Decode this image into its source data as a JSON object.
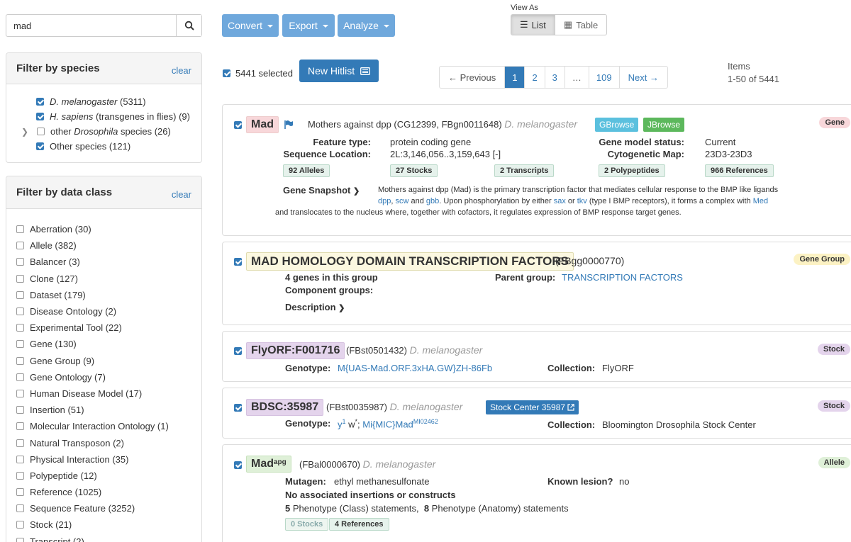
{
  "search": {
    "value": "mad"
  },
  "species_filter": {
    "title": "Filter by species",
    "clear": "clear",
    "items": [
      {
        "prefix": "",
        "italic": "D. melanogaster",
        "suffix": " (5311)",
        "checked": true
      },
      {
        "prefix": "",
        "italic": "H. sapiens",
        "suffix": " (transgenes in flies) (9)",
        "checked": true
      },
      {
        "prefix": "other ",
        "italic": "Drosophila",
        "suffix": " species (26)",
        "checked": false
      },
      {
        "prefix": "Other species (121)",
        "italic": "",
        "suffix": "",
        "checked": true
      }
    ]
  },
  "class_filter": {
    "title": "Filter by data class",
    "clear": "clear",
    "items": [
      "Aberration (30)",
      "Allele (382)",
      "Balancer (3)",
      "Clone (127)",
      "Dataset (179)",
      "Disease Ontology (2)",
      "Experimental Tool (22)",
      "Gene (130)",
      "Gene Group (9)",
      "Gene Ontology (7)",
      "Human Disease Model (17)",
      "Insertion (51)",
      "Molecular Interaction Ontology (1)",
      "Natural Transposon (2)",
      "Physical Interaction (35)",
      "Polypeptide (12)",
      "Reference (1025)",
      "Sequence Feature (3252)",
      "Stock (21)",
      "Transcript (2)"
    ]
  },
  "toolbar": {
    "convert": "Convert",
    "export": "Export",
    "analyze": "Analyze",
    "view_as": "View As",
    "list": "List",
    "table": "Table"
  },
  "selection": {
    "selected": "5441 selected",
    "new_hitlist": "New Hitlist"
  },
  "pager": {
    "prev": "← Previous",
    "pages": [
      "1",
      "2",
      "3",
      "…",
      "109"
    ],
    "next": "Next →"
  },
  "items_info": {
    "label": "Items",
    "range": "1-50 of 5441"
  },
  "results": {
    "gene": {
      "symbol": "Mad",
      "desc": "Mothers against dpp (CG12399, FBgn0011648)",
      "species": "D. melanogaster",
      "gbrowse": "GBrowse",
      "jbrowse": "JBrowse",
      "tag": "Gene",
      "feature_type_label": "Feature type:",
      "feature_type": "protein coding gene",
      "seq_loc_label": "Sequence Location:",
      "seq_loc": "2L:3,146,056..3,159,643 [-]",
      "model_status_label": "Gene model status:",
      "model_status": "Current",
      "cyto_label": "Cytogenetic Map:",
      "cyto": "23D3-23D3",
      "chips": [
        "92 Alleles",
        "27 Stocks",
        "2 Transcripts",
        "2 Polypeptides",
        "966 References"
      ],
      "snapshot_label": "Gene Snapshot",
      "snapshot": {
        "t1": "Mothers against dpp (Mad) is the primary transcription factor that mediates cellular response to the BMP like ligands",
        "l1": "dpp",
        "t2": ", ",
        "l2": "scw",
        "t3": " and ",
        "l3": "gbb",
        "t4": ". Upon phosphorylation by either ",
        "l4": "sax",
        "t5": " or ",
        "l5": "tkv",
        "t6": " (type I BMP receptors), it forms a complex with ",
        "l6": "Med",
        "t7": "and translocates to the nucleus where, together with cofactors, it regulates expression of BMP response target genes."
      }
    },
    "group": {
      "symbol": "MAD HOMOLOGY DOMAIN TRANSCRIPTION FACTORS",
      "id": "(FBgg0000770)",
      "tag": "Gene Group",
      "genes": "4 genes in this group",
      "components_label": "Component groups:",
      "parent_label": "Parent group:",
      "parent": "TRANSCRIPTION FACTORS",
      "description": "Description"
    },
    "flyorf": {
      "symbol": "FlyORF:F001716",
      "id": "(FBst0501432)",
      "species": "D. melanogaster",
      "tag": "Stock",
      "genotype_label": "Genotype:",
      "genotype": "M{UAS-Mad.ORF.3xHA.GW}ZH-86Fb",
      "collection_label": "Collection:",
      "collection": "FlyORF"
    },
    "bdsc": {
      "symbol": "BDSC:35987",
      "id": "(FBst0035987)",
      "species": "D. melanogaster",
      "stock_center": "Stock Center 35987",
      "tag": "Stock",
      "genotype_label": "Genotype:",
      "g1": "y",
      "g1sup": "1",
      "g2": " w",
      "g2sup": "*",
      "g3": "; ",
      "g4": "Mi{MIC}Mad",
      "g4sup": "MI02462",
      "collection_label": "Collection:",
      "collection": "Bloomington Drosophila Stock Center"
    },
    "allele": {
      "symbol": "Mad",
      "symbol_sup": "apg",
      "id": "(FBal0000670)",
      "species": "D. melanogaster",
      "tag": "Allele",
      "mutagen_label": "Mutagen:",
      "mutagen": "ethyl methanesulfonate",
      "lesion_label": "Known lesion?",
      "lesion": "no",
      "no_assoc": "No associated insertions or constructs",
      "pheno_n1": "5",
      "pheno_t1": " Phenotype (Class) statements,  ",
      "pheno_n2": "8",
      "pheno_t2": " Phenotype (Anatomy) statements",
      "chips": [
        "0 Stocks",
        "4 References"
      ]
    }
  },
  "colors": {
    "primary": "#337ab7",
    "toolbar": "#6fa8dc",
    "gbrowse": "#5bc0de",
    "jbrowse": "#5cb85c"
  }
}
